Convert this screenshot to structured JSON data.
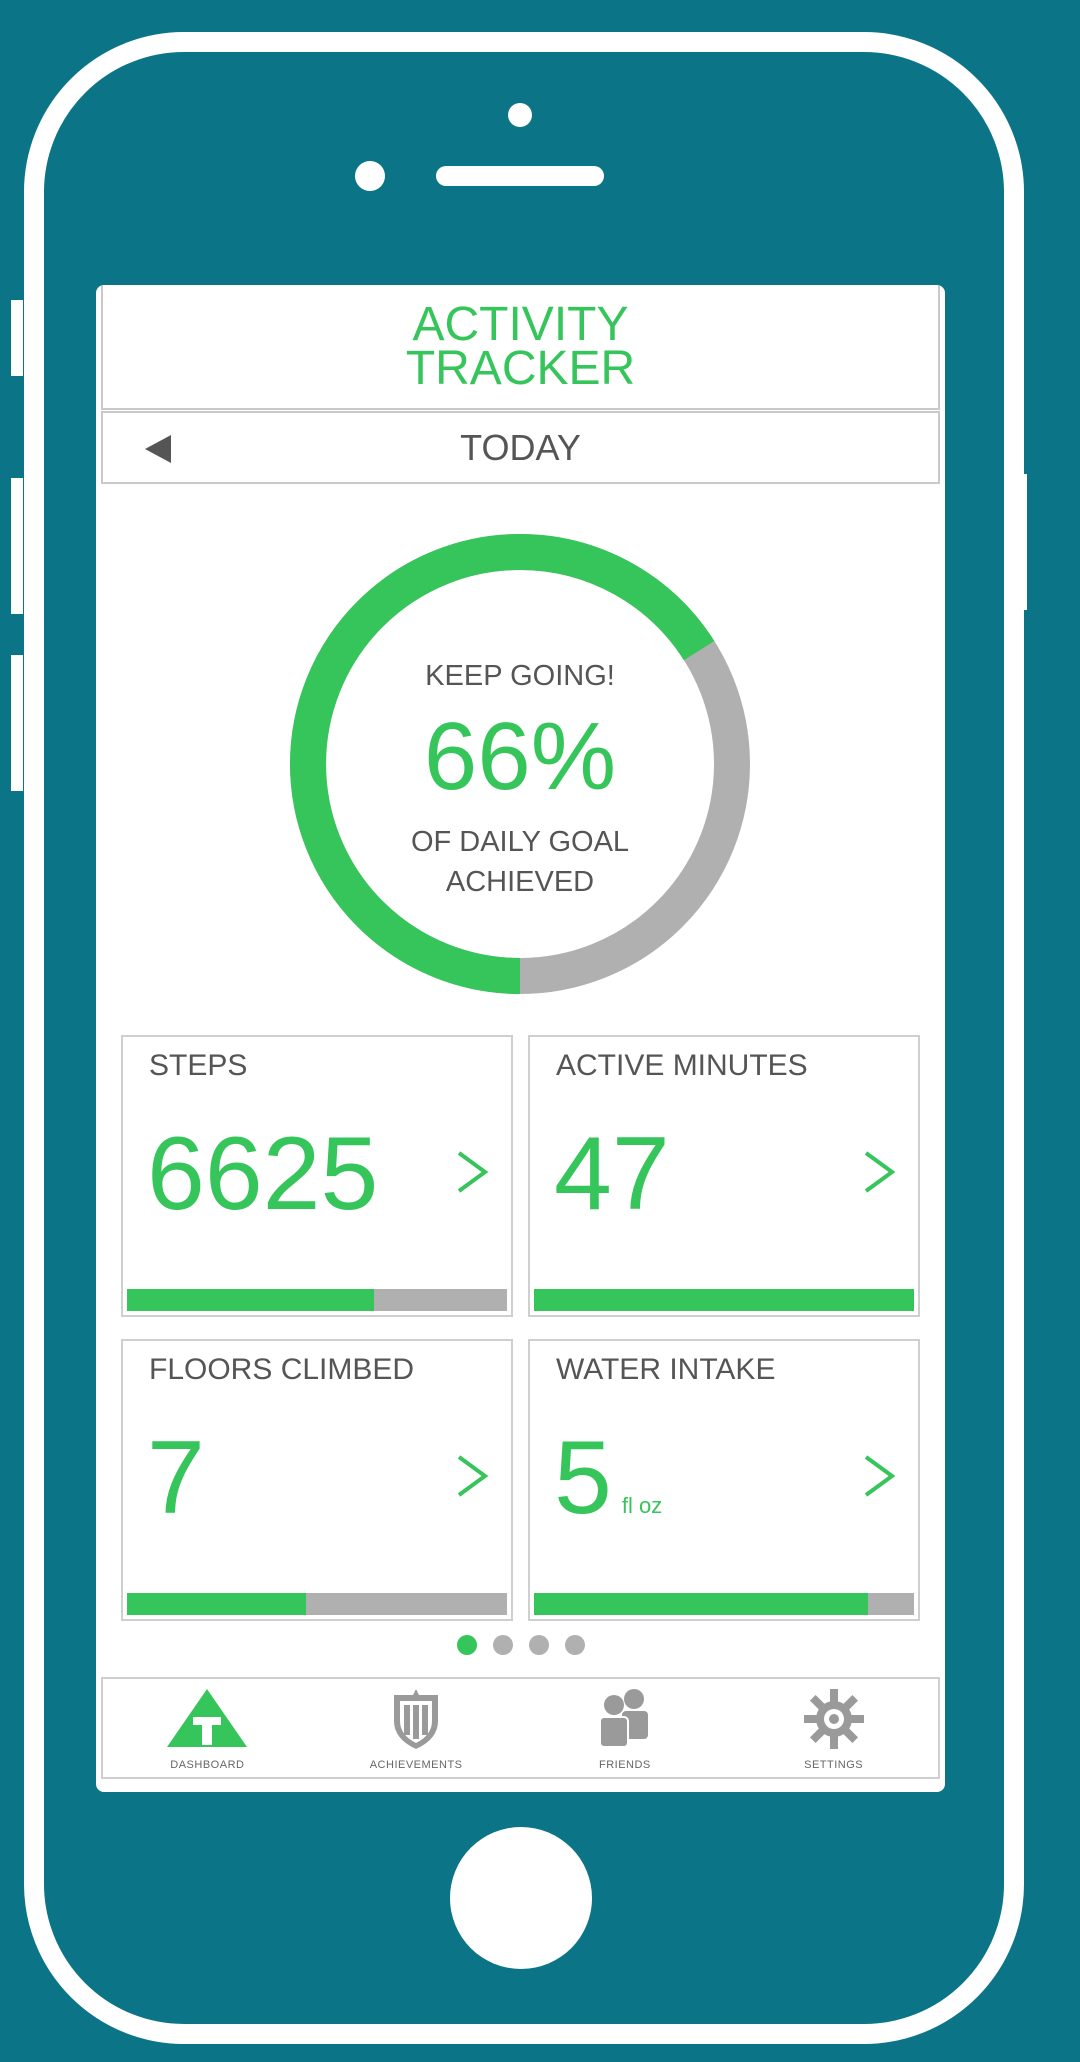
{
  "colors": {
    "background": "#0b7587",
    "accent": "#36c55a",
    "track": "#b0b0b0",
    "text": "#555555"
  },
  "app": {
    "title": "ACTIVITY\nTRACKER"
  },
  "datebar": {
    "label": "TODAY",
    "back_icon": "back-triangle-icon"
  },
  "goal": {
    "top_text": "KEEP GOING!",
    "percent_text": "66%",
    "progress": 0.66,
    "bottom_text": "OF DAILY GOAL\nACHIEVED"
  },
  "cards": [
    {
      "label": "STEPS",
      "value": "6625",
      "unit": "",
      "progress": 0.65
    },
    {
      "label": "ACTIVE MINUTES",
      "value": "47",
      "unit": "",
      "progress": 1.0
    },
    {
      "label": "FLOORS CLIMBED",
      "value": "7",
      "unit": "",
      "progress": 0.47
    },
    {
      "label": "WATER INTAKE",
      "value": "5",
      "unit": "fl oz",
      "progress": 0.88
    }
  ],
  "pager": {
    "pages": 4,
    "active": 1
  },
  "tabs": [
    {
      "label": "DASHBOARD",
      "icon": "dashboard-icon"
    },
    {
      "label": "ACHIEVEMENTS",
      "icon": "achievements-icon"
    },
    {
      "label": "FRIENDS",
      "icon": "friends-icon"
    },
    {
      "label": "SETTINGS",
      "icon": "settings-icon"
    }
  ]
}
